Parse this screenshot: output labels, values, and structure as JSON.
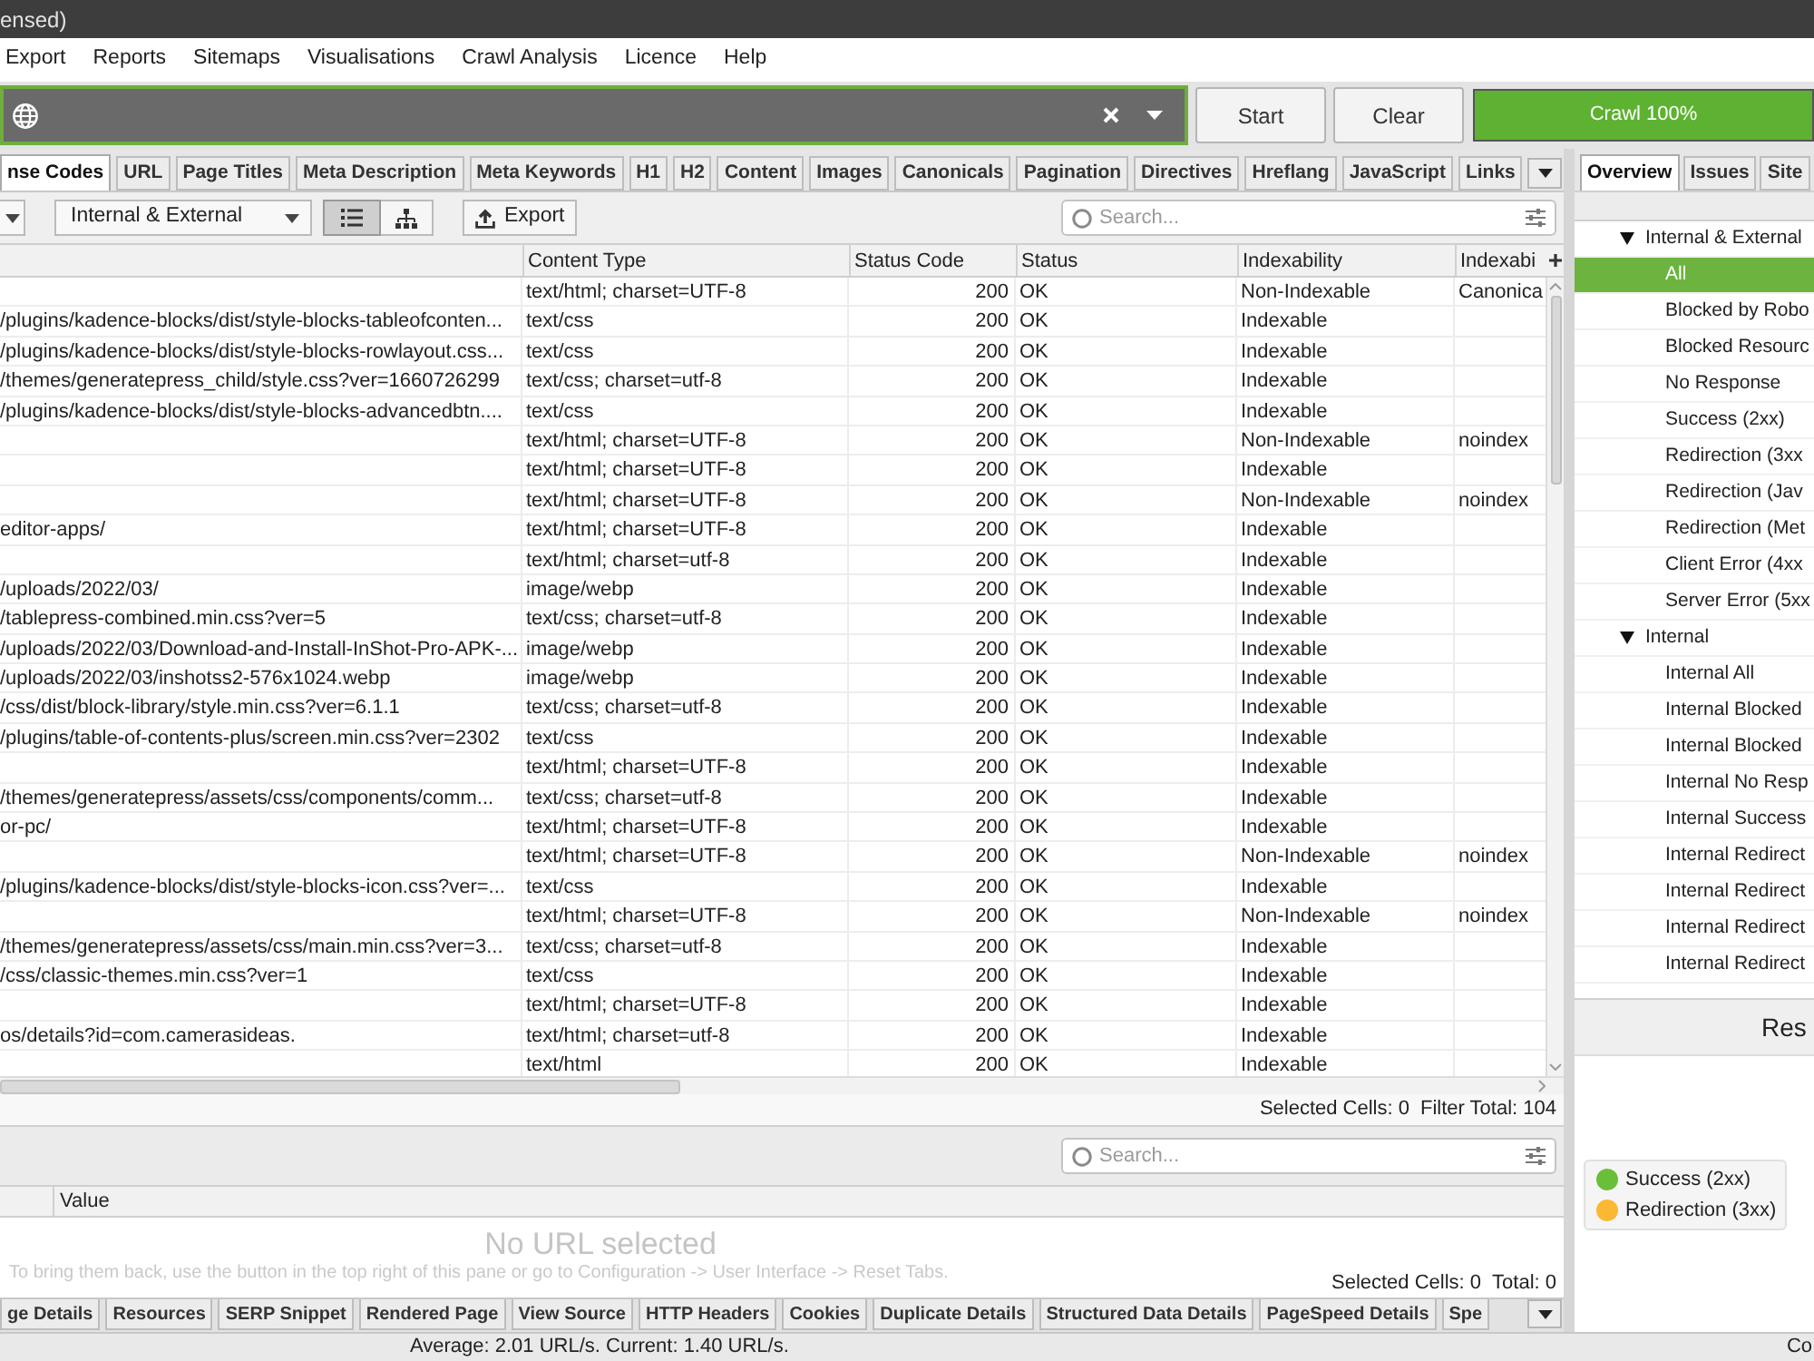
{
  "window": {
    "title": "ensed)"
  },
  "menu": [
    "Export",
    "Reports",
    "Sitemaps",
    "Visualisations",
    "Crawl Analysis",
    "Licence",
    "Help"
  ],
  "url_bar": {
    "buttons": [
      "Start",
      "Clear"
    ],
    "progress": {
      "label": "Crawl 100%",
      "level": 1
    }
  },
  "tabs": [
    {
      "label": "nse Codes",
      "selected": true
    },
    {
      "label": "URL",
      "selected": false
    },
    {
      "label": "Page Titles",
      "selected": false
    },
    {
      "label": "Meta Description",
      "selected": false
    },
    {
      "label": "Meta Keywords",
      "selected": false
    },
    {
      "label": "H1",
      "selected": false
    },
    {
      "label": "H2",
      "selected": false
    },
    {
      "label": "Content",
      "selected": false
    },
    {
      "label": "Images",
      "selected": false
    },
    {
      "label": "Canonicals",
      "selected": false
    },
    {
      "label": "Pagination",
      "selected": false
    },
    {
      "label": "Directives",
      "selected": false
    },
    {
      "label": "Hreflang",
      "selected": false
    },
    {
      "label": "JavaScript",
      "selected": false
    },
    {
      "label": "Links",
      "selected": false
    }
  ],
  "toolbar": {
    "filter": "Internal & External",
    "views": [
      {
        "kind": "list",
        "selected": true
      },
      {
        "kind": "tree",
        "selected": false
      }
    ],
    "export": "Export",
    "search": {
      "placeholder": "Search..."
    }
  },
  "table": {
    "columns": [
      "Content Type",
      "Status Code",
      "Status",
      "Indexability",
      "Indexabi"
    ],
    "rows": [
      {
        "content_type": "text/html; charset=UTF-8",
        "status_code": "200",
        "status": "OK",
        "indexability": "Non-Indexable",
        "column_6": "Canonica"
      },
      {
        "column_1": "/plugins/kadence-blocks/dist/style-blocks-tableofconten...",
        "content_type": "text/css",
        "status_code": "200",
        "status": "OK",
        "indexability": "Indexable"
      },
      {
        "column_1": "/plugins/kadence-blocks/dist/style-blocks-rowlayout.css...",
        "content_type": "text/css",
        "status_code": "200",
        "status": "OK",
        "indexability": "Indexable"
      },
      {
        "column_1": "/themes/generatepress_child/style.css?ver=1660726299",
        "content_type": "text/css; charset=utf-8",
        "status_code": "200",
        "status": "OK",
        "indexability": "Indexable"
      },
      {
        "column_1": "/plugins/kadence-blocks/dist/style-blocks-advancedbtn....",
        "content_type": "text/css",
        "status_code": "200",
        "status": "OK",
        "indexability": "Indexable"
      },
      {
        "content_type": "text/html; charset=UTF-8",
        "status_code": "200",
        "status": "OK",
        "indexability": "Non-Indexable",
        "column_6": "noindex"
      },
      {
        "content_type": "text/html; charset=UTF-8",
        "status_code": "200",
        "status": "OK",
        "indexability": "Indexable"
      },
      {
        "content_type": "text/html; charset=UTF-8",
        "status_code": "200",
        "status": "OK",
        "indexability": "Non-Indexable",
        "column_6": "noindex"
      },
      {
        "column_1": "editor-apps/",
        "content_type": "text/html; charset=UTF-8",
        "status_code": "200",
        "status": "OK",
        "indexability": "Indexable"
      },
      {
        "content_type": "text/html; charset=utf-8",
        "status_code": "200",
        "status": "OK",
        "indexability": "Indexable"
      },
      {
        "column_1": "/uploads/2022/03/",
        "content_type": "image/webp",
        "status_code": "200",
        "status": "OK",
        "indexability": "Indexable"
      },
      {
        "column_1": "/tablepress-combined.min.css?ver=5",
        "content_type": "text/css; charset=utf-8",
        "status_code": "200",
        "status": "OK",
        "indexability": "Indexable"
      },
      {
        "column_1": "/uploads/2022/03/Download-and-Install-InShot-Pro-APK-...",
        "content_type": "image/webp",
        "status_code": "200",
        "status": "OK",
        "indexability": "Indexable"
      },
      {
        "column_1": "/uploads/2022/03/inshotss2-576x1024.webp",
        "content_type": "image/webp",
        "status_code": "200",
        "status": "OK",
        "indexability": "Indexable"
      },
      {
        "column_1": "/css/dist/block-library/style.min.css?ver=6.1.1",
        "content_type": "text/css; charset=utf-8",
        "status_code": "200",
        "status": "OK",
        "indexability": "Indexable"
      },
      {
        "column_1": "/plugins/table-of-contents-plus/screen.min.css?ver=2302",
        "content_type": "text/css",
        "status_code": "200",
        "status": "OK",
        "indexability": "Indexable"
      },
      {
        "content_type": "text/html; charset=UTF-8",
        "status_code": "200",
        "status": "OK",
        "indexability": "Indexable"
      },
      {
        "column_1": "/themes/generatepress/assets/css/components/comm...",
        "content_type": "text/css; charset=utf-8",
        "status_code": "200",
        "status": "OK",
        "indexability": "Indexable"
      },
      {
        "column_1": "or-pc/",
        "content_type": "text/html; charset=UTF-8",
        "status_code": "200",
        "status": "OK",
        "indexability": "Indexable"
      },
      {
        "content_type": "text/html; charset=UTF-8",
        "status_code": "200",
        "status": "OK",
        "indexability": "Non-Indexable",
        "column_6": "noindex"
      },
      {
        "column_1": "/plugins/kadence-blocks/dist/style-blocks-icon.css?ver=...",
        "content_type": "text/css",
        "status_code": "200",
        "status": "OK",
        "indexability": "Indexable"
      },
      {
        "content_type": "text/html; charset=UTF-8",
        "status_code": "200",
        "status": "OK",
        "indexability": "Non-Indexable",
        "column_6": "noindex"
      },
      {
        "column_1": "/themes/generatepress/assets/css/main.min.css?ver=3...",
        "content_type": "text/css; charset=utf-8",
        "status_code": "200",
        "status": "OK",
        "indexability": "Indexable"
      },
      {
        "column_1": "/css/classic-themes.min.css?ver=1",
        "content_type": "text/css",
        "status_code": "200",
        "status": "OK",
        "indexability": "Indexable"
      },
      {
        "content_type": "text/html; charset=UTF-8",
        "status_code": "200",
        "status": "OK",
        "indexability": "Indexable"
      },
      {
        "column_1": "os/details?id=com.camerasideas.",
        "content_type": "text/html; charset=utf-8",
        "status_code": "200",
        "status": "OK",
        "indexability": "Indexable"
      },
      {
        "content_type": "text/html",
        "status_code": "200",
        "status": "OK",
        "indexability": "Indexable"
      }
    ]
  },
  "table_status": {
    "selected_cells": "Selected Cells: 0",
    "filter_total": "Filter Total: 104"
  },
  "details_panel": {
    "search": {
      "placeholder": "Search..."
    },
    "columns": [
      "Value"
    ],
    "empty_message": "No URL selected",
    "hint": "To bring them back, use the button in the top right of this pane or go to Configuration -> User Interface -> Reset Tabs.",
    "selected_cells": "Selected Cells: 0",
    "total": "Total: 0"
  },
  "bottom_tabs": [
    {
      "label": "ge Details",
      "selected": false
    },
    {
      "label": "Resources",
      "selected": false
    },
    {
      "label": "SERP Snippet",
      "selected": false
    },
    {
      "label": "Rendered Page",
      "selected": false
    },
    {
      "label": "View Source",
      "selected": false
    },
    {
      "label": "HTTP Headers",
      "selected": false
    },
    {
      "label": "Cookies",
      "selected": false
    },
    {
      "label": "Duplicate Details",
      "selected": false
    },
    {
      "label": "Structured Data Details",
      "selected": false
    },
    {
      "label": "PageSpeed Details",
      "selected": false
    },
    {
      "label": "Spe",
      "selected": false
    }
  ],
  "side_panel": {
    "tabs": [
      {
        "label": "Overview",
        "selected": true
      },
      {
        "label": "Issues",
        "selected": false
      },
      {
        "label": "Site",
        "selected": false
      }
    ],
    "tree": [
      {
        "label": "Internal & External",
        "expanded": true,
        "selected": false,
        "children": [
          {
            "label": "All",
            "selected": true
          },
          {
            "label": "Blocked by Robo",
            "selected": false
          },
          {
            "label": "Blocked Resourc",
            "selected": false
          },
          {
            "label": "No Response",
            "selected": false
          },
          {
            "label": "Success (2xx)",
            "selected": false
          },
          {
            "label": "Redirection (3xx",
            "selected": false
          },
          {
            "label": "Redirection (Jav",
            "selected": false
          },
          {
            "label": "Redirection (Met",
            "selected": false
          },
          {
            "label": "Client Error (4xx",
            "selected": false
          },
          {
            "label": "Server Error (5xx",
            "selected": false
          }
        ]
      },
      {
        "label": "Internal",
        "expanded": true,
        "selected": false,
        "children": [
          {
            "label": "Internal All",
            "selected": false
          },
          {
            "label": "Internal Blocked",
            "selected": false
          },
          {
            "label": "Internal Blocked",
            "selected": false
          },
          {
            "label": "Internal No Resp",
            "selected": false
          },
          {
            "label": "Internal Success",
            "selected": false
          },
          {
            "label": "Internal Redirect",
            "selected": false
          },
          {
            "label": "Internal Redirect",
            "selected": false
          },
          {
            "label": "Internal Redirect",
            "selected": false
          },
          {
            "label": "Internal Redirect",
            "selected": false
          }
        ]
      }
    ],
    "chart": {
      "title": "Res",
      "legend": [
        {
          "label": "Success (2xx)",
          "color": "#6abf3a"
        },
        {
          "label": "Redirection (3xx)",
          "color": "#fbb832"
        }
      ]
    }
  },
  "status_bar": {
    "text": "Average: 2.01 URL/s. Current: 1.40 URL/s.",
    "right": "Co"
  }
}
